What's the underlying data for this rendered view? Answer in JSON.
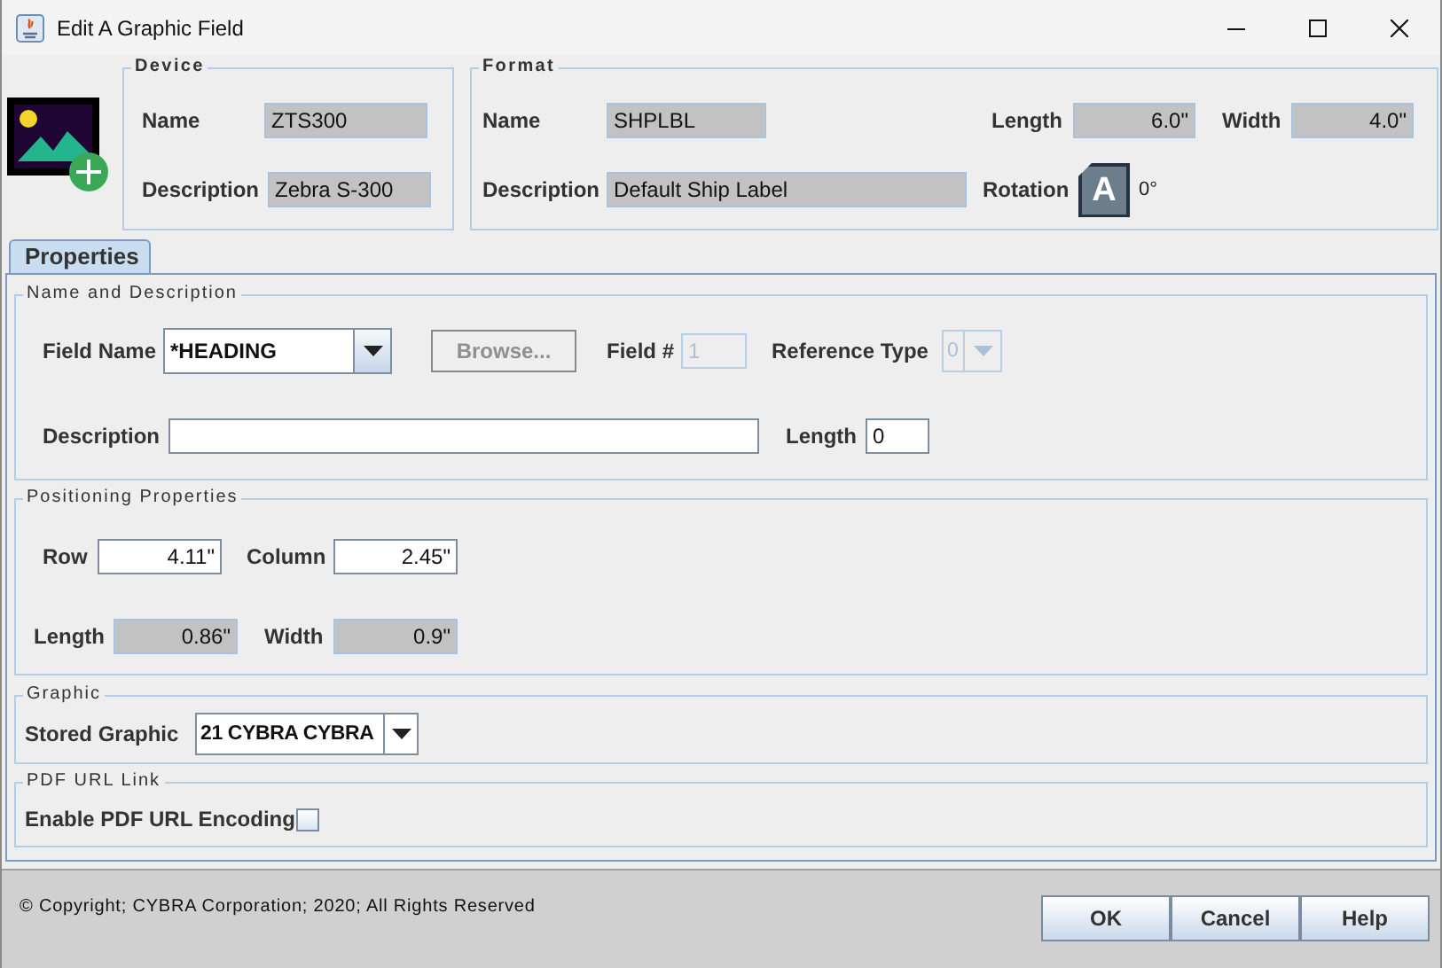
{
  "window": {
    "title": "Edit A Graphic Field"
  },
  "device": {
    "legend": "Device",
    "name": {
      "label": "Name",
      "value": "ZTS300",
      "editable": false
    },
    "description": {
      "label": "Description",
      "value": "Zebra S-300",
      "editable": false
    }
  },
  "format": {
    "legend": "Format",
    "name": {
      "label": "Name",
      "value": "SHPLBL",
      "editable": false
    },
    "length": {
      "label": "Length",
      "value": "6.0\"",
      "editable": false
    },
    "width": {
      "label": "Width",
      "value": "4.0\"",
      "editable": false
    },
    "description": {
      "label": "Description",
      "value": "Default Ship Label",
      "editable": false
    },
    "rotation": {
      "label": "Rotation",
      "badge": "A",
      "value": "0°"
    }
  },
  "tabs": [
    {
      "label": "Properties",
      "selected": true
    }
  ],
  "name_and_description": {
    "legend": "Name and Description",
    "field_name": {
      "label": "Field Name",
      "value": "*HEADING",
      "editable": true
    },
    "browse_button": {
      "label": "Browse...",
      "disabled": true
    },
    "field_number": {
      "label": "Field #",
      "value": "1",
      "disabled": true
    },
    "reference_type": {
      "label": "Reference Type",
      "value": "0",
      "disabled": true
    },
    "description": {
      "label": "Description",
      "editable": true
    },
    "length": {
      "label": "Length",
      "value": "0",
      "editable": true
    }
  },
  "positioning": {
    "legend": "Positioning Properties",
    "row": {
      "label": "Row",
      "value": "4.11\"",
      "editable": true
    },
    "column": {
      "label": "Column",
      "value": "2.45\"",
      "editable": true
    },
    "length": {
      "label": "Length",
      "value": "0.86\"",
      "editable": false
    },
    "width": {
      "label": "Width",
      "value": "0.9\"",
      "editable": false
    }
  },
  "graphic": {
    "legend": "Graphic",
    "stored_graphic": {
      "label": "Stored Graphic",
      "value": "21 CYBRA CYBRA",
      "editable": false
    }
  },
  "pdf_url_link": {
    "legend": "PDF URL Link",
    "enable_encoding": {
      "label": "Enable PDF URL Encoding",
      "checked": false
    }
  },
  "copyright": "© Copyright; CYBRA Corporation; 2020; All Rights Reserved",
  "buttons": [
    {
      "label": "OK"
    },
    {
      "label": "Cancel"
    },
    {
      "label": "Help"
    }
  ]
}
